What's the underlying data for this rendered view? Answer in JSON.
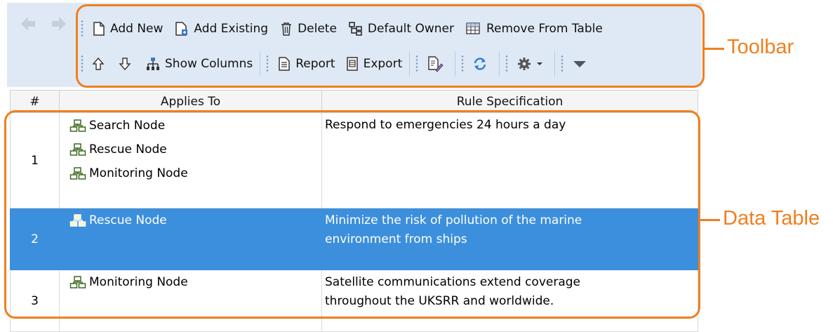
{
  "toolbar": {
    "row1": [
      {
        "label": "Add New",
        "icon": "new-document-icon"
      },
      {
        "label": "Add Existing",
        "icon": "add-existing-icon"
      },
      {
        "label": "Delete",
        "icon": "trash-icon"
      },
      {
        "label": "Default Owner",
        "icon": "hierarchy-icon"
      },
      {
        "label": "Remove From Table",
        "icon": "remove-table-icon"
      }
    ],
    "row2": {
      "show_columns": "Show Columns",
      "report": "Report",
      "export": "Export"
    }
  },
  "callouts": {
    "toolbar": "Toolbar",
    "data_table": "Data Table",
    "color": "#f07f1f"
  },
  "table": {
    "headers": [
      "#",
      "Applies To",
      "Rule Specification"
    ],
    "rows": [
      {
        "num": "1",
        "applies": [
          "Search Node",
          "Rescue Node",
          "Monitoring Node"
        ],
        "spec_lines": [
          "Respond to emergencies 24 hours a day"
        ],
        "selected": false
      },
      {
        "num": "2",
        "applies": [
          "Rescue Node"
        ],
        "spec_lines": [
          "Minimize the risk of pollution of the marine",
          "environment from ships"
        ],
        "selected": true
      },
      {
        "num": "3",
        "applies": [
          "Monitoring Node"
        ],
        "spec_lines": [
          "Satellite communications extend coverage",
          "throughout the UKSRR and worldwide."
        ],
        "selected": false
      }
    ],
    "selection_color": "#3c8fdc"
  }
}
